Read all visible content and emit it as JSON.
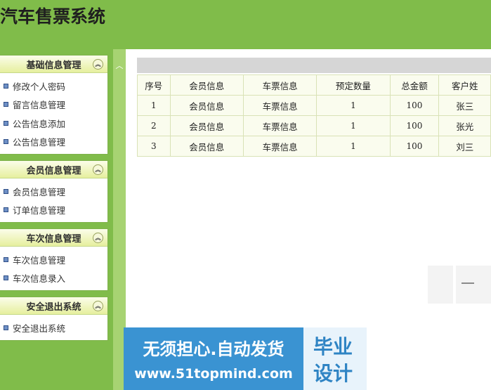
{
  "app": {
    "title": "汽车售票系统"
  },
  "sidebar": {
    "panels": [
      {
        "title": "基础信息管理",
        "items": [
          "修改个人密码",
          "留言信息管理",
          "公告信息添加",
          "公告信息管理"
        ]
      },
      {
        "title": "会员信息管理",
        "items": [
          "会员信息管理",
          "订单信息管理"
        ]
      },
      {
        "title": "车次信息管理",
        "items": [
          "车次信息管理",
          "车次信息录入"
        ]
      },
      {
        "title": "安全退出系统",
        "items": [
          "安全退出系统"
        ]
      }
    ]
  },
  "table": {
    "headers": [
      "序号",
      "会员信息",
      "车票信息",
      "预定数量",
      "总金额",
      "客户姓"
    ],
    "rows": [
      [
        "1",
        "会员信息",
        "车票信息",
        "1",
        "100",
        "张三"
      ],
      [
        "2",
        "会员信息",
        "车票信息",
        "1",
        "100",
        "张光"
      ],
      [
        "3",
        "会员信息",
        "车票信息",
        "1",
        "100",
        "刘三"
      ]
    ]
  },
  "watermark": {
    "line1": "无须担心.自动发货",
    "line2": "www.51topmind.com",
    "side1": "毕业",
    "side2": "设计"
  },
  "icons": {
    "collapse": "double-chevron-up-icon",
    "bullet": "square-bullet-icon",
    "toggle": "chevron-up-icon"
  },
  "colors": {
    "background": "#80bc4a",
    "panel_header": "#e6ef9e",
    "banner": "#3a93d2"
  }
}
